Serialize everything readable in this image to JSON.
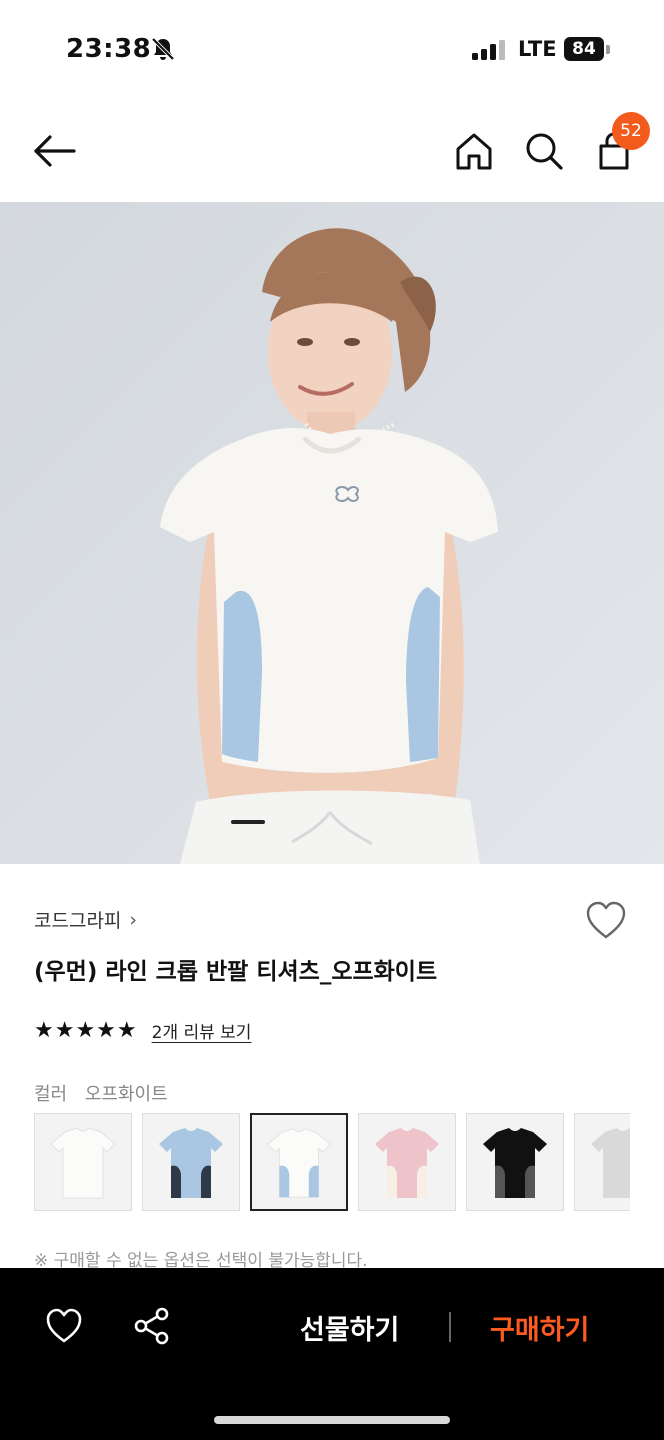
{
  "status_bar": {
    "time": "23:38",
    "network": "LTE",
    "battery": "84"
  },
  "nav": {
    "cart_count": "52"
  },
  "product": {
    "brand": "코드그라피",
    "brand_chevron": "›",
    "title": "(우먼) 라인 크롭 반팔 티셔츠_오프화이트",
    "stars": "★★★★★",
    "rating_stars": 5,
    "review_link": "2개 리뷰 보기",
    "color_label": "컬러",
    "color_value": "오프화이트",
    "notice": "※ 구매할 수 없는 옵션은 선택이 불가능합니다."
  },
  "bottom_bar": {
    "gift_label": "선물하기",
    "buy_label": "구매하기"
  },
  "colors": {
    "accent": "#ff5a1f",
    "badge": "#f35b1c",
    "panel_blue": "#a9c7e3"
  }
}
